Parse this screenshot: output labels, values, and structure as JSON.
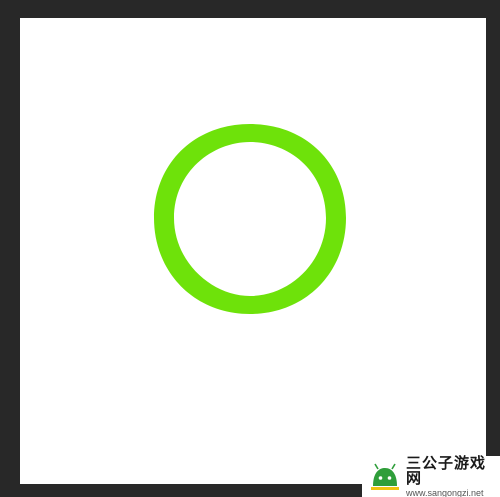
{
  "colors": {
    "workspace_bg": "#282828",
    "canvas_bg": "#ffffff",
    "ring_stroke": "#6ee20a"
  },
  "canvas": {
    "shape": "ring-icon"
  },
  "watermark": {
    "icon": "android-logo-icon",
    "title": "三公子游戏网",
    "url": "www.sangongzi.net"
  }
}
